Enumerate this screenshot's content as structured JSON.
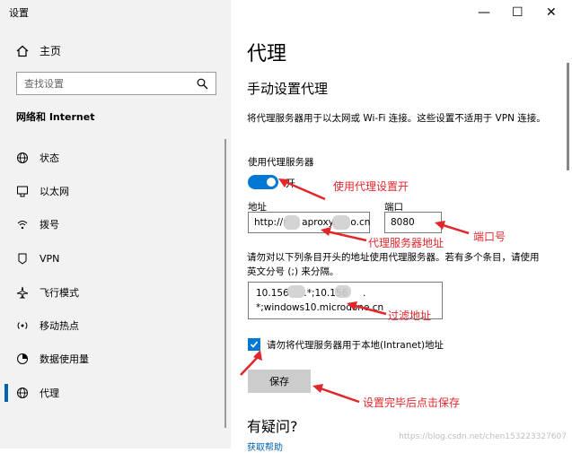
{
  "window": {
    "title": "设置",
    "controls": {
      "minimize": "—",
      "maximize": "☐",
      "close": "✕"
    }
  },
  "sidebar": {
    "home_label": "主页",
    "search_placeholder": "查找设置",
    "section_title": "网络和 Internet",
    "items": [
      {
        "label": "状态",
        "icon": "globe-status-icon"
      },
      {
        "label": "以太网",
        "icon": "ethernet-icon"
      },
      {
        "label": "拨号",
        "icon": "dialup-icon"
      },
      {
        "label": "VPN",
        "icon": "vpn-icon"
      },
      {
        "label": "飞行模式",
        "icon": "airplane-icon"
      },
      {
        "label": "移动热点",
        "icon": "hotspot-icon"
      },
      {
        "label": "数据使用量",
        "icon": "data-usage-icon"
      },
      {
        "label": "代理",
        "icon": "globe-proxy-icon",
        "active": true
      }
    ]
  },
  "main": {
    "page_title": "代理",
    "section_title": "手动设置代理",
    "description": "将代理服务器用于以太网或 Wi-Fi 连接。这些设置不适用于 VPN 连接。",
    "use_proxy_label": "使用代理服务器",
    "toggle_state": "开",
    "address_label": "地址",
    "address_value": "http://r     aproxy.     o.cn",
    "port_label": "端口",
    "port_value": "8080",
    "exceptions_desc": "请勿对以下列条目开头的地址使用代理服务器。若有多个条目，请使用英文分号 (;) 来分隔。",
    "exceptions_line1": "10.156     .*;10.156     .",
    "exceptions_line2": "*;windows10.microdone.cn",
    "local_checkbox_label": "请勿将代理服务器用于本地(Intranet)地址",
    "save_label": "保存",
    "help_title": "有疑问?",
    "help_link": "获取帮助"
  },
  "annotations": {
    "toggle_note": "使用代理设置开",
    "address_note": "代理服务器地址",
    "port_note": "端口号",
    "exceptions_note": "过滤地址",
    "save_note": "设置完毕后点击保存"
  },
  "watermark": "https://blog.csdn.net/chen153223327607",
  "colors": {
    "accent": "#0078d4",
    "annotation": "#e0282c",
    "sidebar_bg": "#f2f2f2"
  }
}
